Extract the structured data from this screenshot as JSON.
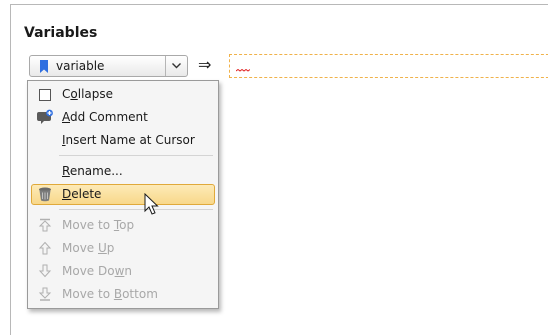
{
  "section": {
    "title": "Variables"
  },
  "variable_selector": {
    "label": "variable",
    "icon": "bookmark-icon",
    "dropdown_icon": "chevron-down-icon"
  },
  "assign_arrow": "⇒",
  "value_input": {
    "value": ""
  },
  "context_menu": {
    "collapse": {
      "pre": "C",
      "acc": "o",
      "post": "llapse",
      "checked": false
    },
    "add_comment": {
      "pre": "",
      "acc": "A",
      "post": "dd Comment",
      "icon": "comment-add-icon"
    },
    "insert_name": {
      "pre": "",
      "acc": "I",
      "post": "nsert Name at Cursor"
    },
    "rename": {
      "pre": "",
      "acc": "R",
      "post": "ename..."
    },
    "delete": {
      "pre": "",
      "acc": "D",
      "post": "elete",
      "icon": "trash-can-icon",
      "highlighted": true
    },
    "move_to_top": {
      "pre": "Move to ",
      "acc": "T",
      "post": "op",
      "enabled": false
    },
    "move_up": {
      "pre": "Move ",
      "acc": "U",
      "post": "p",
      "enabled": false
    },
    "move_down": {
      "pre": "Move Do",
      "acc": "w",
      "post": "n",
      "enabled": false
    },
    "move_to_bottom": {
      "pre": "Move to ",
      "acc": "B",
      "post": "ottom",
      "enabled": false
    }
  },
  "colors": {
    "highlight_fill": "#f8d88a",
    "highlight_border": "#e0a93a",
    "field_border": "#f0b24a",
    "bookmark": "#2f6fe0",
    "disabled_text": "#a8a8a8"
  }
}
